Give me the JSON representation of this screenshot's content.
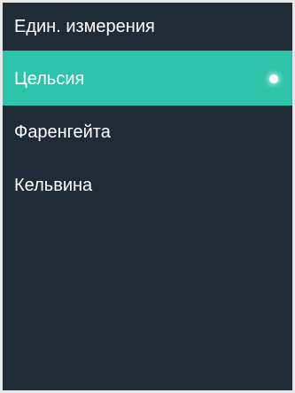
{
  "header": {
    "title": "Един. измерения"
  },
  "options": [
    {
      "label": "Цельсия",
      "selected": true
    },
    {
      "label": "Фаренгейта",
      "selected": false
    },
    {
      "label": "Кельвина",
      "selected": false
    }
  ],
  "colors": {
    "background": "#1f2b36",
    "accent": "#2ec4ac",
    "text": "#ffffff"
  }
}
